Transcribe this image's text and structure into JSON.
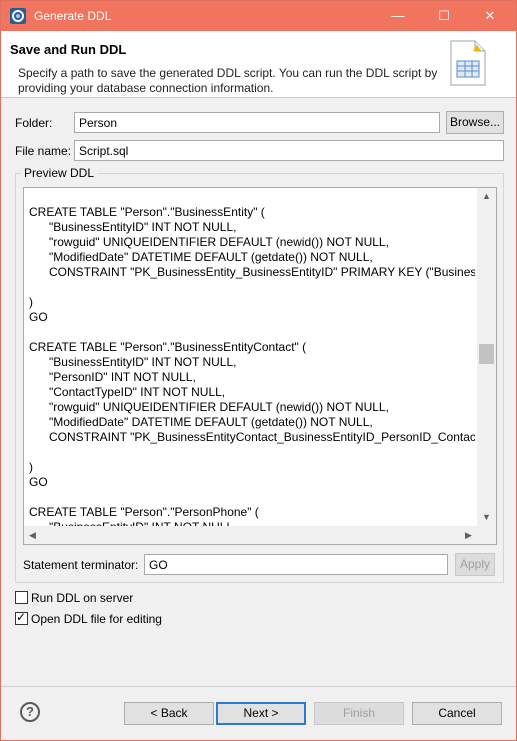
{
  "window": {
    "title": "Generate DDL",
    "minimize_glyph": "—",
    "maximize_glyph": "☐",
    "close_glyph": "✕",
    "accent_color": "#f0745e"
  },
  "header": {
    "title": "Save and Run DDL",
    "description": "Specify a path to save the generated DDL script. You can run the DDL script by providing your database connection information."
  },
  "form": {
    "folder_label": "Folder:",
    "folder_value": "Person",
    "browse_label": "Browse...",
    "filename_label": "File name:",
    "filename_value": "Script.sql"
  },
  "preview": {
    "legend": "Preview DDL",
    "lines": [
      "CREATE TABLE \"Person\".\"BusinessEntity\" (",
      "      \"BusinessEntityID\" INT NOT NULL,",
      "      \"rowguid\" UNIQUEIDENTIFIER DEFAULT (newid()) NOT NULL,",
      "      \"ModifiedDate\" DATETIME DEFAULT (getdate()) NOT NULL,",
      "      CONSTRAINT \"PK_BusinessEntity_BusinessEntityID\" PRIMARY KEY (\"BusinessEnti",
      "",
      ")",
      "GO",
      "",
      "CREATE TABLE \"Person\".\"BusinessEntityContact\" (",
      "      \"BusinessEntityID\" INT NOT NULL,",
      "      \"PersonID\" INT NOT NULL,",
      "      \"ContactTypeID\" INT NOT NULL,",
      "      \"rowguid\" UNIQUEIDENTIFIER DEFAULT (newid()) NOT NULL,",
      "      \"ModifiedDate\" DATETIME DEFAULT (getdate()) NOT NULL,",
      "      CONSTRAINT \"PK_BusinessEntityContact_BusinessEntityID_PersonID_ContactTyp",
      "",
      ")",
      "GO",
      "",
      "CREATE TABLE \"Person\".\"PersonPhone\" (",
      "      \"BusinessEntityID\" INT NOT NULL,"
    ]
  },
  "terminator": {
    "label": "Statement terminator:",
    "value": "GO",
    "apply_label": "Apply"
  },
  "options": {
    "run_on_server_label": "Run DDL on server",
    "run_on_server_checked": false,
    "open_for_editing_label": "Open DDL file for editing",
    "open_for_editing_checked": true
  },
  "footer": {
    "help_glyph": "?",
    "back_label": "< Back",
    "next_label": "Next >",
    "finish_label": "Finish",
    "cancel_label": "Cancel"
  }
}
